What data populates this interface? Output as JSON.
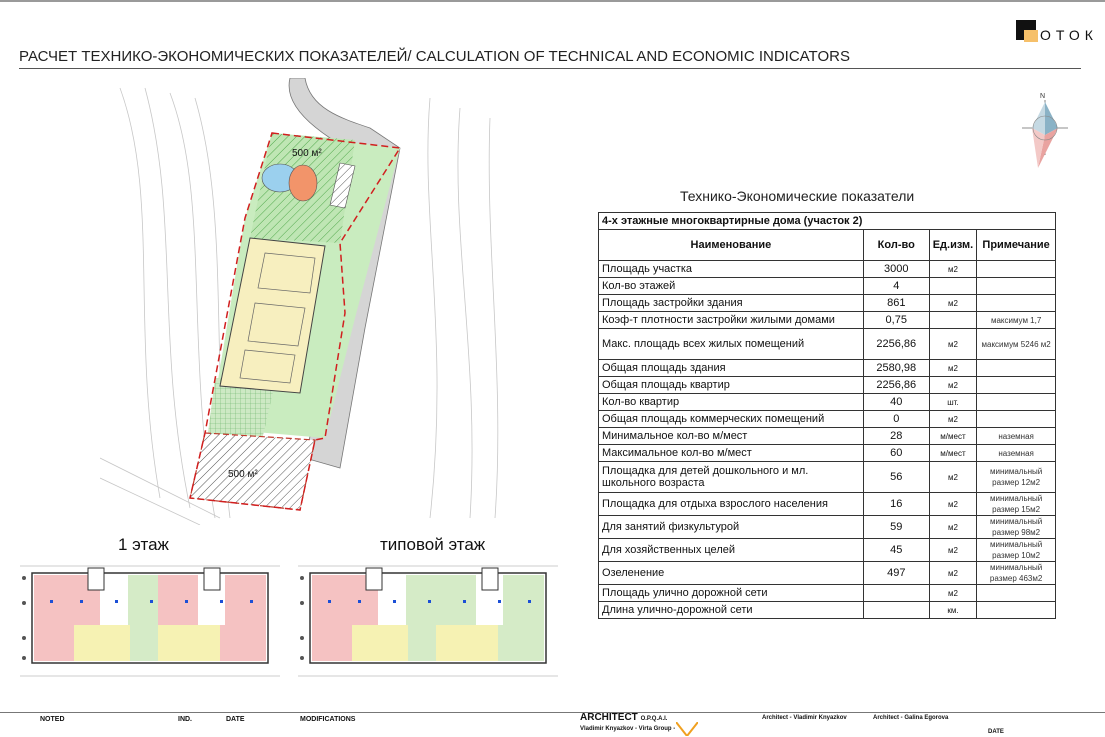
{
  "header": {
    "title": "РАСЧЕТ ТЕХНИКО-ЭКОНОМИЧЕСКИХ ПОКАЗАТЕЛЕЙ/ CALCULATION OF TECHNICAL AND ECONOMIC INDICATORS",
    "logo_text": "ОТОК"
  },
  "siteplan": {
    "area_label_top": "500 м²",
    "area_label_bottom": "500 м²"
  },
  "compass": {
    "north": "N"
  },
  "table": {
    "caption": "Технико-Экономические показатели",
    "subtitle": "4-х этажные многоквартирные дома (участок 2)",
    "headers": {
      "name": "Наименование",
      "qty": "Кол-во",
      "unit": "Ед.изм.",
      "note": "Примечание"
    },
    "rows": [
      {
        "name": "Площадь участка",
        "qty": "3000",
        "unit": "м2",
        "note": ""
      },
      {
        "name": "Кол-во этажей",
        "qty": "4",
        "unit": "",
        "note": ""
      },
      {
        "name": "Площадь застройки здания",
        "qty": "861",
        "unit": "м2",
        "note": ""
      },
      {
        "name": "Коэф-т плотности застройки жилыми домами",
        "qty": "0,75",
        "unit": "",
        "note": "максимум 1,7"
      },
      {
        "name": "Макс. площадь всех жилых помещений",
        "qty": "2256,86",
        "unit": "м2",
        "note": "максимум 5246 м2"
      },
      {
        "name": "Общая площадь здания",
        "qty": "2580,98",
        "unit": "м2",
        "note": ""
      },
      {
        "name": "Общая площадь квартир",
        "qty": "2256,86",
        "unit": "м2",
        "note": ""
      },
      {
        "name": "Кол-во квартир",
        "qty": "40",
        "unit": "шт.",
        "note": ""
      },
      {
        "name": "Общая площадь коммерческих помещений",
        "qty": "0",
        "unit": "м2",
        "note": ""
      },
      {
        "name": "Минимальное кол-во м/мест",
        "qty": "28",
        "unit": "м/мест",
        "note": "наземная"
      },
      {
        "name": "Максимальное кол-во м/мест",
        "qty": "60",
        "unit": "м/мест",
        "note": "наземная"
      },
      {
        "name": "Площадка для детей дошкольного и мл. школьного возраста",
        "qty": "56",
        "unit": "м2",
        "note": "минимальный размер 12м2"
      },
      {
        "name": "Площадка для отдыха взрослого населения",
        "qty": "16",
        "unit": "м2",
        "note": "минимальный размер 15м2"
      },
      {
        "name": "Для занятий физкультурой",
        "qty": "59",
        "unit": "м2",
        "note": "минимальный размер 98м2"
      },
      {
        "name": "Для хозяйственных целей",
        "qty": "45",
        "unit": "м2",
        "note": "минимальный размер 10м2"
      },
      {
        "name": "Озеленение",
        "qty": "497",
        "unit": "м2",
        "note": "минимальный размер 463м2"
      },
      {
        "name": "Площадь улично дорожной сети",
        "qty": "",
        "unit": "м2",
        "note": ""
      },
      {
        "name": "Длина улично-дорожной сети",
        "qty": "",
        "unit": "км.",
        "note": ""
      }
    ]
  },
  "plans": {
    "first_floor_label": "1 этаж",
    "typical_floor_label": "типовой этаж"
  },
  "footer": {
    "noted": "NOTED",
    "ind": "IND.",
    "date": "DATE",
    "modifications": "MODIFICATIONS",
    "architect": "ARCHITECT",
    "architect_suffix": "O.P.Q.A.I.",
    "architect_sub": "Vladimir Knyazkov - Virta Group -",
    "architect_1": "Architect - Vladimir Knyazkov",
    "architect_2": "Architect - Galina Egorova",
    "date_right": "DATE"
  }
}
